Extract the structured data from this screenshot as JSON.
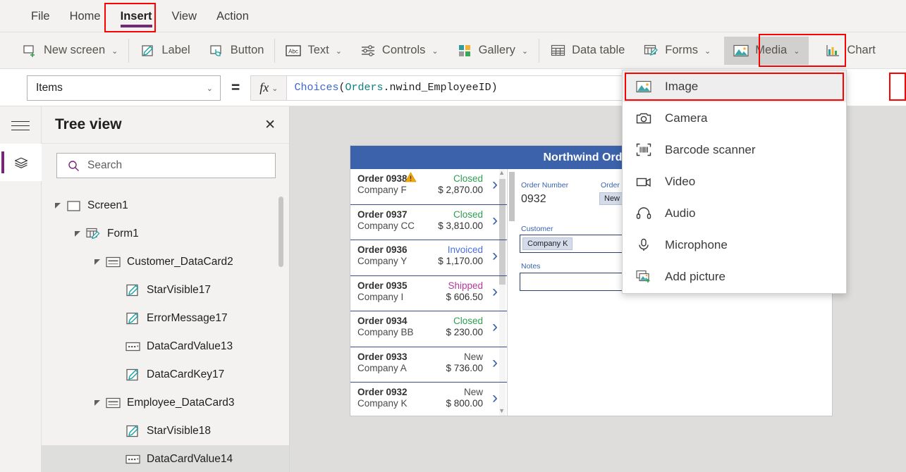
{
  "menu": {
    "items": [
      {
        "label": "File",
        "active": false
      },
      {
        "label": "Home",
        "active": false
      },
      {
        "label": "Insert",
        "active": true
      },
      {
        "label": "View",
        "active": false
      },
      {
        "label": "Action",
        "active": false
      }
    ]
  },
  "ribbon": {
    "items": [
      {
        "label": "New screen",
        "icon": "new-screen-icon",
        "chevron": "⌄",
        "selected": false
      },
      {
        "label": "Label",
        "icon": "label-icon",
        "chevron": "",
        "selected": false
      },
      {
        "label": "Button",
        "icon": "button-icon",
        "chevron": "",
        "selected": false
      },
      {
        "label": "Text",
        "icon": "text-abc-icon",
        "chevron": "⌄",
        "selected": false
      },
      {
        "label": "Controls",
        "icon": "controls-sliders-icon",
        "chevron": "⌄",
        "selected": false
      },
      {
        "label": "Gallery",
        "icon": "gallery-grid-icon",
        "chevron": "⌄",
        "selected": false
      },
      {
        "label": "Data table",
        "icon": "data-table-icon",
        "chevron": "",
        "selected": false
      },
      {
        "label": "Forms",
        "icon": "forms-icon",
        "chevron": "⌄",
        "selected": false
      },
      {
        "label": "Media",
        "icon": "media-image-icon",
        "chevron": "⌄",
        "selected": true
      },
      {
        "label": "Chart",
        "icon": "chart-icon",
        "chevron": "⌄",
        "selected": false
      }
    ]
  },
  "formula_bar": {
    "property_selected": "Items",
    "property_chevron": "⌄",
    "equals": "=",
    "fx_label": "fx",
    "fx_chevron": "⌄",
    "formula_parts": {
      "fn": "Choices",
      "open": "(",
      "table": "Orders",
      "dot": ".",
      "column": "nwind_EmployeeID",
      "close": ")"
    },
    "formula_full": "Choices(Orders.nwind_EmployeeID)"
  },
  "rail": {
    "hamburger": "hamburger-icon",
    "active_tool": "tree-view-layers-icon"
  },
  "tree_view": {
    "title": "Tree view",
    "close": "✕",
    "search_placeholder": "Search",
    "nodes": [
      {
        "label": "Screen1",
        "depth": 0,
        "caret": true,
        "icon": "screen-icon",
        "selected": false
      },
      {
        "label": "Form1",
        "depth": 1,
        "caret": true,
        "icon": "form-icon",
        "selected": false
      },
      {
        "label": "Customer_DataCard2",
        "depth": 2,
        "caret": true,
        "icon": "datacard-icon",
        "selected": false
      },
      {
        "label": "StarVisible17",
        "depth": 3,
        "caret": false,
        "icon": "label-pencil-icon",
        "selected": false
      },
      {
        "label": "ErrorMessage17",
        "depth": 3,
        "caret": false,
        "icon": "label-pencil-icon",
        "selected": false
      },
      {
        "label": "DataCardValue13",
        "depth": 3,
        "caret": false,
        "icon": "dropdown-value-icon",
        "selected": false
      },
      {
        "label": "DataCardKey17",
        "depth": 3,
        "caret": false,
        "icon": "label-pencil-icon",
        "selected": false
      },
      {
        "label": "Employee_DataCard3",
        "depth": 2,
        "caret": true,
        "icon": "datacard-icon",
        "selected": false
      },
      {
        "label": "StarVisible18",
        "depth": 3,
        "caret": false,
        "icon": "label-pencil-icon",
        "selected": false
      },
      {
        "label": "DataCardValue14",
        "depth": 3,
        "caret": false,
        "icon": "dropdown-value-icon",
        "selected": true
      }
    ]
  },
  "canvas": {
    "app_title": "Northwind Orders",
    "gallery": [
      {
        "order": "Order 0938",
        "company": "Company F",
        "status": "Closed",
        "status_color": "#2e9e4f",
        "amount": "$ 2,870.00",
        "warning": true
      },
      {
        "order": "Order 0937",
        "company": "Company CC",
        "status": "Closed",
        "status_color": "#2e9e4f",
        "amount": "$ 3,810.00",
        "warning": false
      },
      {
        "order": "Order 0936",
        "company": "Company Y",
        "status": "Invoiced",
        "status_color": "#4a6ee0",
        "amount": "$ 1,170.00",
        "warning": false
      },
      {
        "order": "Order 0935",
        "company": "Company I",
        "status": "Shipped",
        "status_color": "#b5389a",
        "amount": "$ 606.50",
        "warning": false
      },
      {
        "order": "Order 0934",
        "company": "Company BB",
        "status": "Closed",
        "status_color": "#2e9e4f",
        "amount": "$ 230.00",
        "warning": false
      },
      {
        "order": "Order 0933",
        "company": "Company A",
        "status": "New",
        "status_color": "#4a4a4a",
        "amount": "$ 736.00",
        "warning": false
      },
      {
        "order": "Order 0932",
        "company": "Company K",
        "status": "New",
        "status_color": "#4a4a4a",
        "amount": "$ 800.00",
        "warning": false
      }
    ],
    "detail": {
      "order_number_label": "Order Number",
      "order_number_value": "0932",
      "order_status_label": "Order Status",
      "order_status_value": "New",
      "customer_label": "Customer",
      "customer_value": "Company K",
      "notes_label": "Notes",
      "notes_value": ""
    }
  },
  "media_menu": {
    "items": [
      {
        "label": "Image",
        "icon": "image-icon",
        "highlighted": true
      },
      {
        "label": "Camera",
        "icon": "camera-icon",
        "highlighted": false
      },
      {
        "label": "Barcode scanner",
        "icon": "barcode-icon",
        "highlighted": false
      },
      {
        "label": "Video",
        "icon": "video-icon",
        "highlighted": false
      },
      {
        "label": "Audio",
        "icon": "audio-icon",
        "highlighted": false
      },
      {
        "label": "Microphone",
        "icon": "microphone-icon",
        "highlighted": false
      },
      {
        "label": "Add picture",
        "icon": "add-picture-icon",
        "highlighted": false
      }
    ]
  },
  "colors": {
    "accent_purple": "#742774",
    "highlight_red": "#ff0000",
    "app_blue": "#3b62ab",
    "ribbon_bg": "#f3f2f1"
  }
}
